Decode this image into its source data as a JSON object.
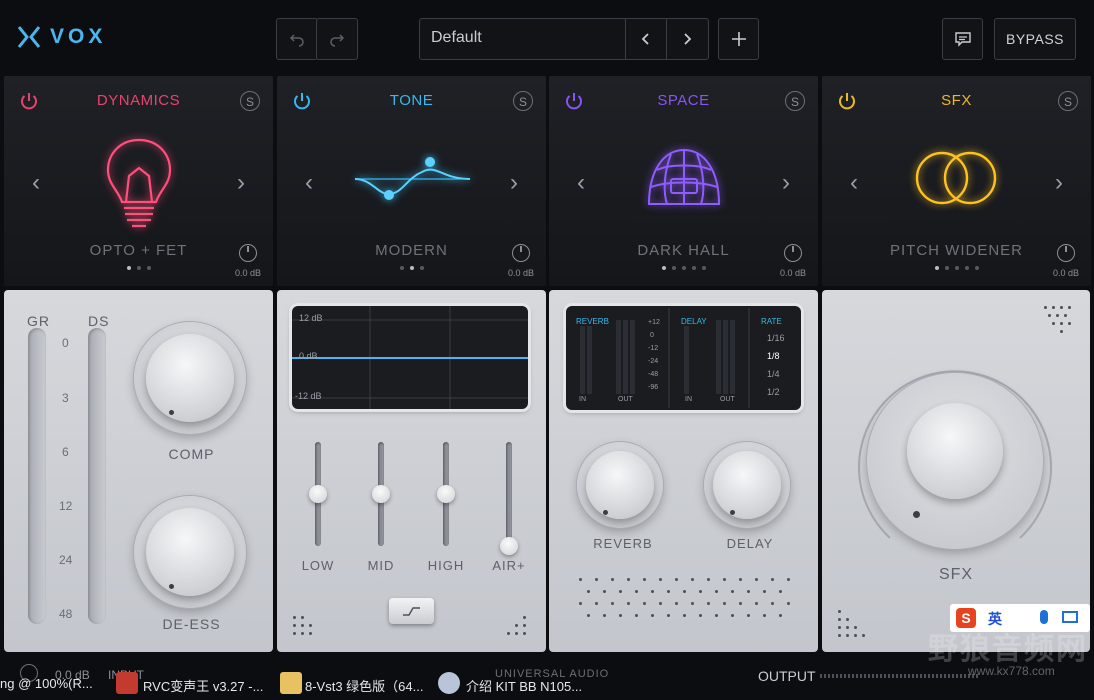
{
  "app": {
    "logo_text": "VOX"
  },
  "toolbar": {
    "preset_name": "Default",
    "bypass_label": "BYPASS"
  },
  "modules": [
    {
      "title": "DYNAMICS",
      "preset": "OPTO + FET",
      "gain": "0.0 dB",
      "color": "#e8436e",
      "icon": "lightbulb-icon"
    },
    {
      "title": "TONE",
      "preset": "MODERN",
      "gain": "0.0 dB",
      "color": "#39b8ee",
      "icon": "eq-curve-icon"
    },
    {
      "title": "SPACE",
      "preset": "DARK HALL",
      "gain": "0.0 dB",
      "color": "#8a54f0",
      "icon": "dome-icon"
    },
    {
      "title": "SFX",
      "preset": "PITCH WIDENER",
      "gain": "0.0 dB",
      "color": "#efb820",
      "icon": "double-circle-icon"
    }
  ],
  "solo_label": "S",
  "dynamics": {
    "gr_label": "GR",
    "ds_label": "DS",
    "scale": [
      "0",
      "3",
      "6",
      "12",
      "24",
      "48"
    ],
    "comp_label": "COMP",
    "deess_label": "DE-ESS"
  },
  "tone": {
    "eq_top": "12 dB",
    "eq_mid": "0 dB",
    "eq_bottom": "-12 dB",
    "sliders": [
      {
        "label": "LOW",
        "value": 0.5
      },
      {
        "label": "MID",
        "value": 0.5
      },
      {
        "label": "HIGH",
        "value": 0.5
      },
      {
        "label": "AIR+",
        "value": 0.0
      }
    ]
  },
  "space": {
    "reverb_label": "REVERB",
    "delay_label": "DELAY",
    "rate_label": "RATE",
    "meter_scale": [
      "+12",
      "0",
      "-12",
      "-24",
      "-48",
      "-96"
    ],
    "in_label": "IN",
    "out_label": "OUT",
    "rates": [
      "1/16",
      "1/8",
      "1/4",
      "1/2"
    ],
    "rate_selected": "1/8",
    "reverb_knob_label": "REVERB",
    "delay_knob_label": "DELAY"
  },
  "sfx": {
    "knob_label": "SFX"
  },
  "bottom": {
    "gain_value": "0.0 dB",
    "input_label": "INPUT",
    "brand": "UNIVERSAL AUDIO",
    "output_label": "OUTPUT"
  },
  "taskbar": [
    {
      "text": "ng @ 100%(R..."
    },
    {
      "text": "RVC变声王 v3.27 -..."
    },
    {
      "text": "8-Vst3 绿色版（64..."
    },
    {
      "text": "介绍 KIT BB N105..."
    }
  ],
  "tray": {
    "ime": "英",
    "watermark": "野狼音频网",
    "watermark_url": "www.kx778.com"
  }
}
